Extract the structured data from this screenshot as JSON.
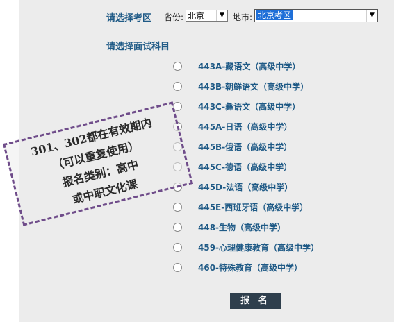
{
  "region": {
    "heading": "请选择考区",
    "province_label": "省份:",
    "province_value": "北京",
    "city_label": "地市:",
    "city_value": "北京考区"
  },
  "subject": {
    "heading": "请选择面试科目",
    "options": [
      "443A-藏语文（高级中学）",
      "443B-朝鲜语文（高级中学）",
      "443C-彝语文（高级中学）",
      "445A-日语（高级中学）",
      "445B-俄语（高级中学）",
      "445C-德语（高级中学）",
      "445D-法语（高级中学）",
      "445E-西班牙语（高级中学）",
      "448-生物（高级中学）",
      "459-心理健康教育（高级中学）",
      "460-特殊教育（高级中学）"
    ]
  },
  "submit_label": "报 名",
  "note": {
    "lines": [
      "301、302都在有效期内",
      "（可以重复使用）",
      "报名类别：高中",
      "或中职文化课"
    ]
  }
}
